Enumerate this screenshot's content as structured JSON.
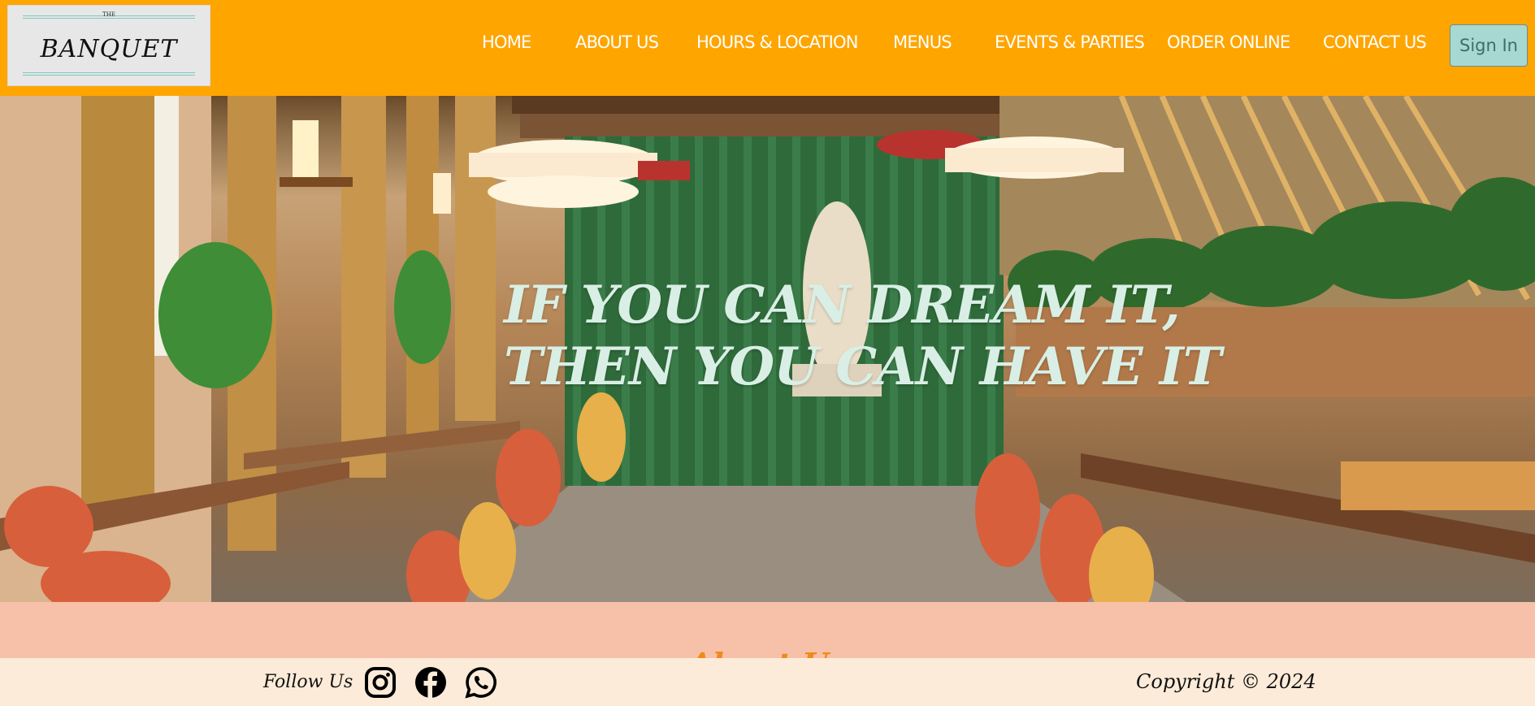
{
  "logo": {
    "small_text": "THE",
    "name": "BANQUET"
  },
  "nav": {
    "items": [
      {
        "label": "HOME"
      },
      {
        "label": "ABOUT US"
      },
      {
        "label": "HOURS & LOCATION"
      },
      {
        "label": "MENUS"
      },
      {
        "label": "EVENTS & PARTIES"
      },
      {
        "label": "ORDER ONLINE"
      },
      {
        "label": "CONTACT US"
      }
    ],
    "sign_in": "Sign In"
  },
  "hero": {
    "headline_line1": "IF YOU CAN DREAM IT,",
    "headline_line2": "THEN YOU CAN HAVE IT"
  },
  "section": {
    "title": "About Us"
  },
  "footer": {
    "follow_label": "Follow Us",
    "social_icons": [
      "instagram-icon",
      "facebook-icon",
      "whatsapp-icon"
    ],
    "copyright": "Copyright © 2024"
  },
  "colors": {
    "header_bg": "#ffa500",
    "sign_in_bg": "#a8d8d2",
    "band_bg": "#f7c1a9",
    "footer_bg": "#fcebd8",
    "headline": "#d9efe5",
    "section_title": "#f08a1a"
  }
}
